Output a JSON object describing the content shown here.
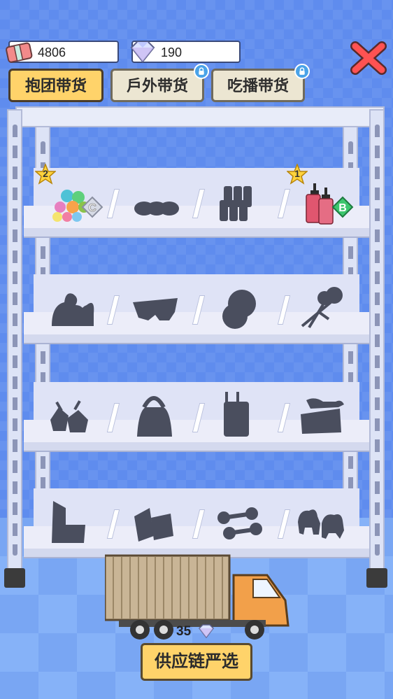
{
  "currencies": {
    "money": {
      "value": "4806",
      "icon": "cash-bundle-icon"
    },
    "gems": {
      "value": "190",
      "icon": "diamond-icon"
    }
  },
  "tabs": [
    {
      "label": "抱团带货",
      "active": true,
      "locked": false
    },
    {
      "label": "戶外带货",
      "active": false,
      "locked": true
    },
    {
      "label": "吃播带货",
      "active": false,
      "locked": true
    }
  ],
  "shelf": {
    "rows": [
      {
        "badge_left": "2",
        "badge_right": "1",
        "items": [
          {
            "name": "plush-toys",
            "unlocked": true,
            "grade": "C"
          },
          {
            "name": "shoes",
            "unlocked": false
          },
          {
            "name": "cups",
            "unlocked": false
          },
          {
            "name": "lotion-bottles",
            "unlocked": true,
            "grade": "B"
          }
        ]
      },
      {
        "items": [
          {
            "name": "toy-figures",
            "unlocked": false
          },
          {
            "name": "slippers",
            "unlocked": false
          },
          {
            "name": "plates",
            "unlocked": false
          },
          {
            "name": "lollipops",
            "unlocked": false
          }
        ]
      },
      {
        "items": [
          {
            "name": "bags-of-food",
            "unlocked": false
          },
          {
            "name": "handbag",
            "unlocked": false
          },
          {
            "name": "luggage",
            "unlocked": false
          },
          {
            "name": "sneakers-box",
            "unlocked": false
          }
        ]
      },
      {
        "items": [
          {
            "name": "sofa",
            "unlocked": false
          },
          {
            "name": "boxes",
            "unlocked": false
          },
          {
            "name": "dumbbells",
            "unlocked": false
          },
          {
            "name": "dog-figures",
            "unlocked": false
          }
        ]
      }
    ]
  },
  "truck": {
    "price": "35",
    "price_icon": "diamond-icon"
  },
  "supply_button": {
    "label": "供应链严选"
  },
  "colors": {
    "active_tab": "#ffd36a",
    "locked_tab": "#ece6d2",
    "close": "#ff4d4d",
    "silhouette": "#4a4e5e"
  }
}
